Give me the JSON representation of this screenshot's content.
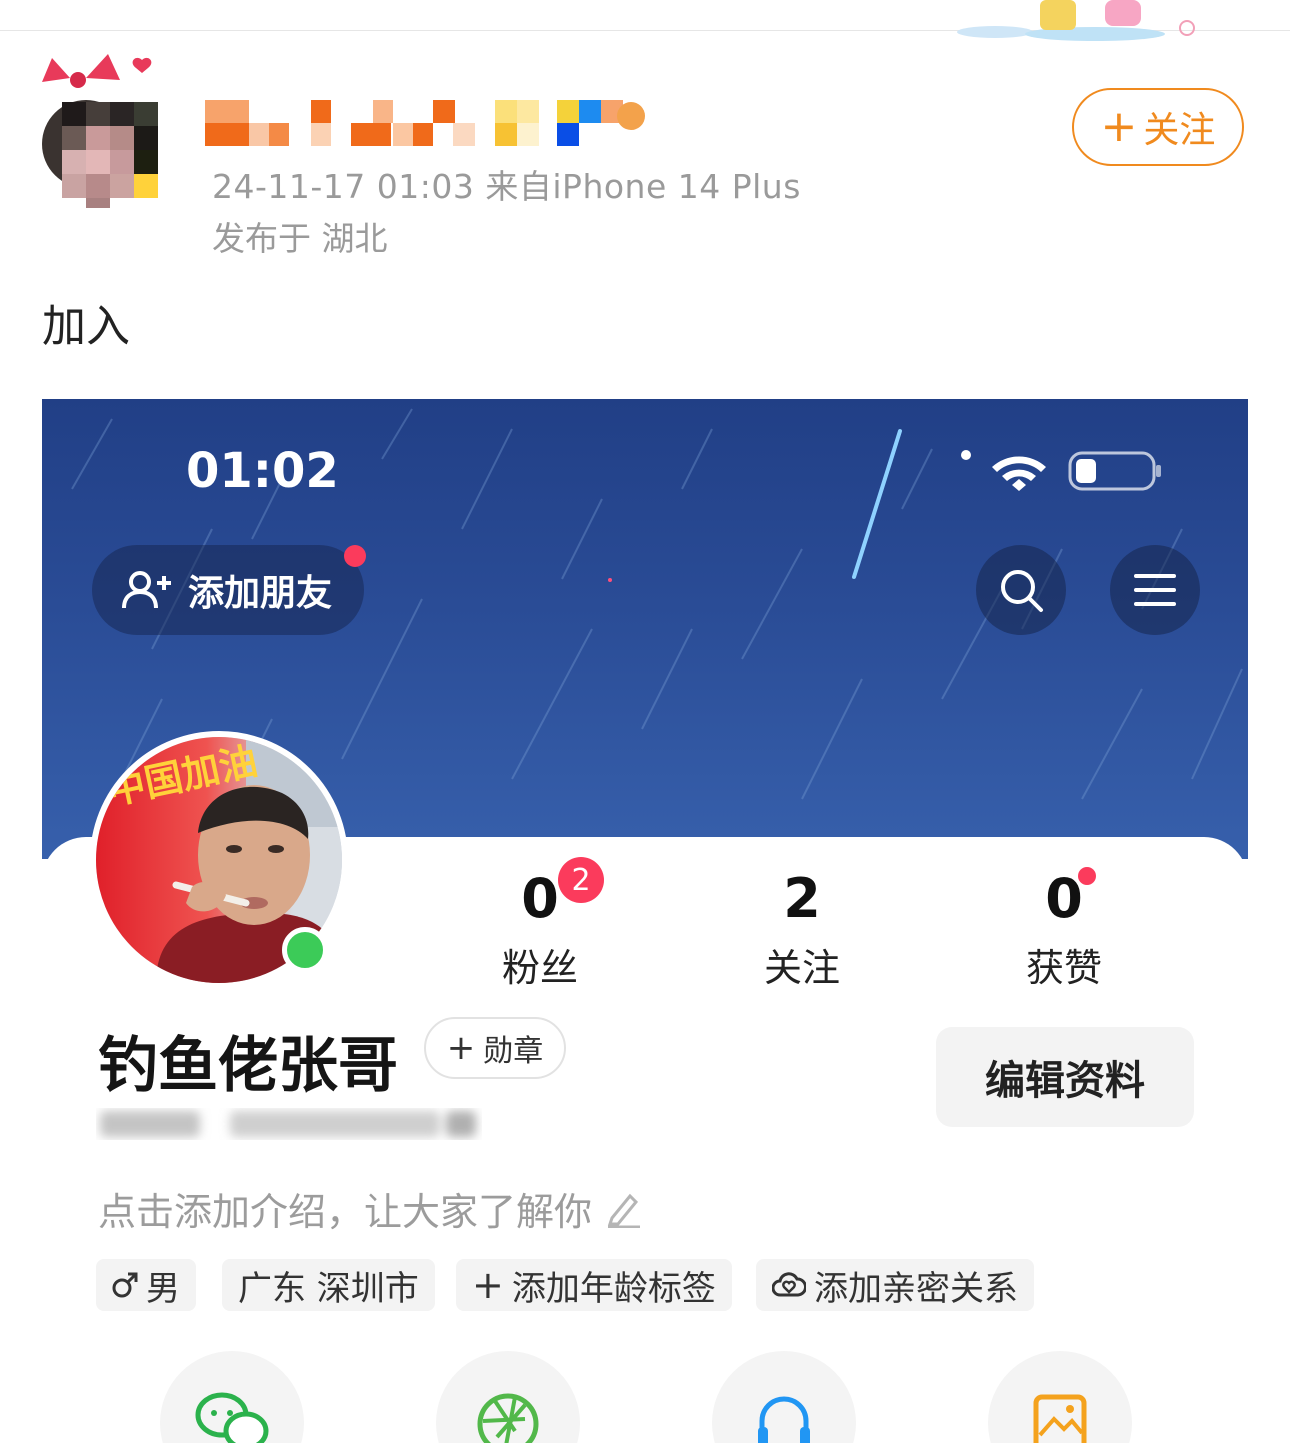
{
  "post": {
    "meta_line": "24-11-17 01:03  来自iPhone 14 Plus",
    "location": "发布于 湖北",
    "follow_label": "关注",
    "text": "加入"
  },
  "embedded": {
    "status_time": "01:02",
    "add_friend_label": "添加朋友",
    "profile": {
      "nickname": "钓鱼佬张哥",
      "medal_label": "勋章",
      "edit_label": "编辑资料",
      "intro_placeholder": "点击添加介绍，让大家了解你",
      "avatar_text": "中国加油"
    },
    "stats": [
      {
        "value": "0",
        "label": "粉丝",
        "badge": "2"
      },
      {
        "value": "2",
        "label": "关注"
      },
      {
        "value": "0",
        "label": "获赞"
      }
    ],
    "tags": [
      {
        "icon": "male-icon",
        "label": "男"
      },
      {
        "label": "广东 深圳市"
      },
      {
        "icon": "plus-icon",
        "label": "添加年龄标签"
      },
      {
        "icon": "cloud-heart-icon",
        "label": "添加亲密关系"
      }
    ],
    "quick_actions": [
      "wechat-icon",
      "camera-aperture-icon",
      "headphones-icon",
      "image-icon"
    ]
  },
  "colors": {
    "accent": "#f08a1e",
    "notification_red": "#fb3b5c",
    "online_green": "#3ccb58",
    "sky_blue": "#2a4c96"
  }
}
